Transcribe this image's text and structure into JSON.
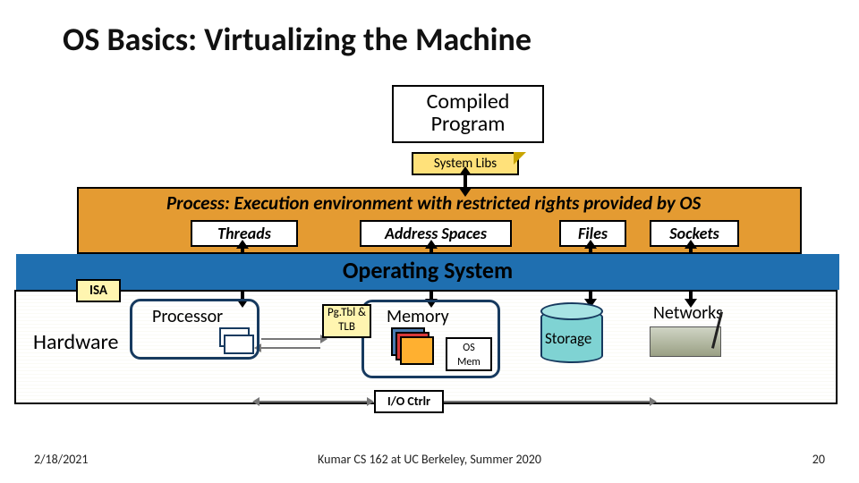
{
  "title": "OS Basics: Virtualizing the Machine",
  "compiled_program": "Compiled\nProgram",
  "system_libs": "System Libs",
  "process_title": "Process: Execution environment with restricted rights provided by OS",
  "process_components": {
    "threads": "Threads",
    "address_spaces": "Address Spaces",
    "files": "Files",
    "sockets": "Sockets"
  },
  "os_label": "Operating System",
  "isa_label": "ISA",
  "hardware_label": "Hardware",
  "hardware": {
    "processor": "Processor",
    "pgtbl": "Pg.Tbl & TLB",
    "memory": "Memory",
    "os_mem": "OS\nMem",
    "storage": "Storage",
    "networks": "Networks",
    "ioctrlr": "I/O Ctrlr"
  },
  "footer": {
    "date": "2/18/2021",
    "center": "Kumar CS 162 at UC Berkeley, Summer 2020",
    "page": "20"
  }
}
